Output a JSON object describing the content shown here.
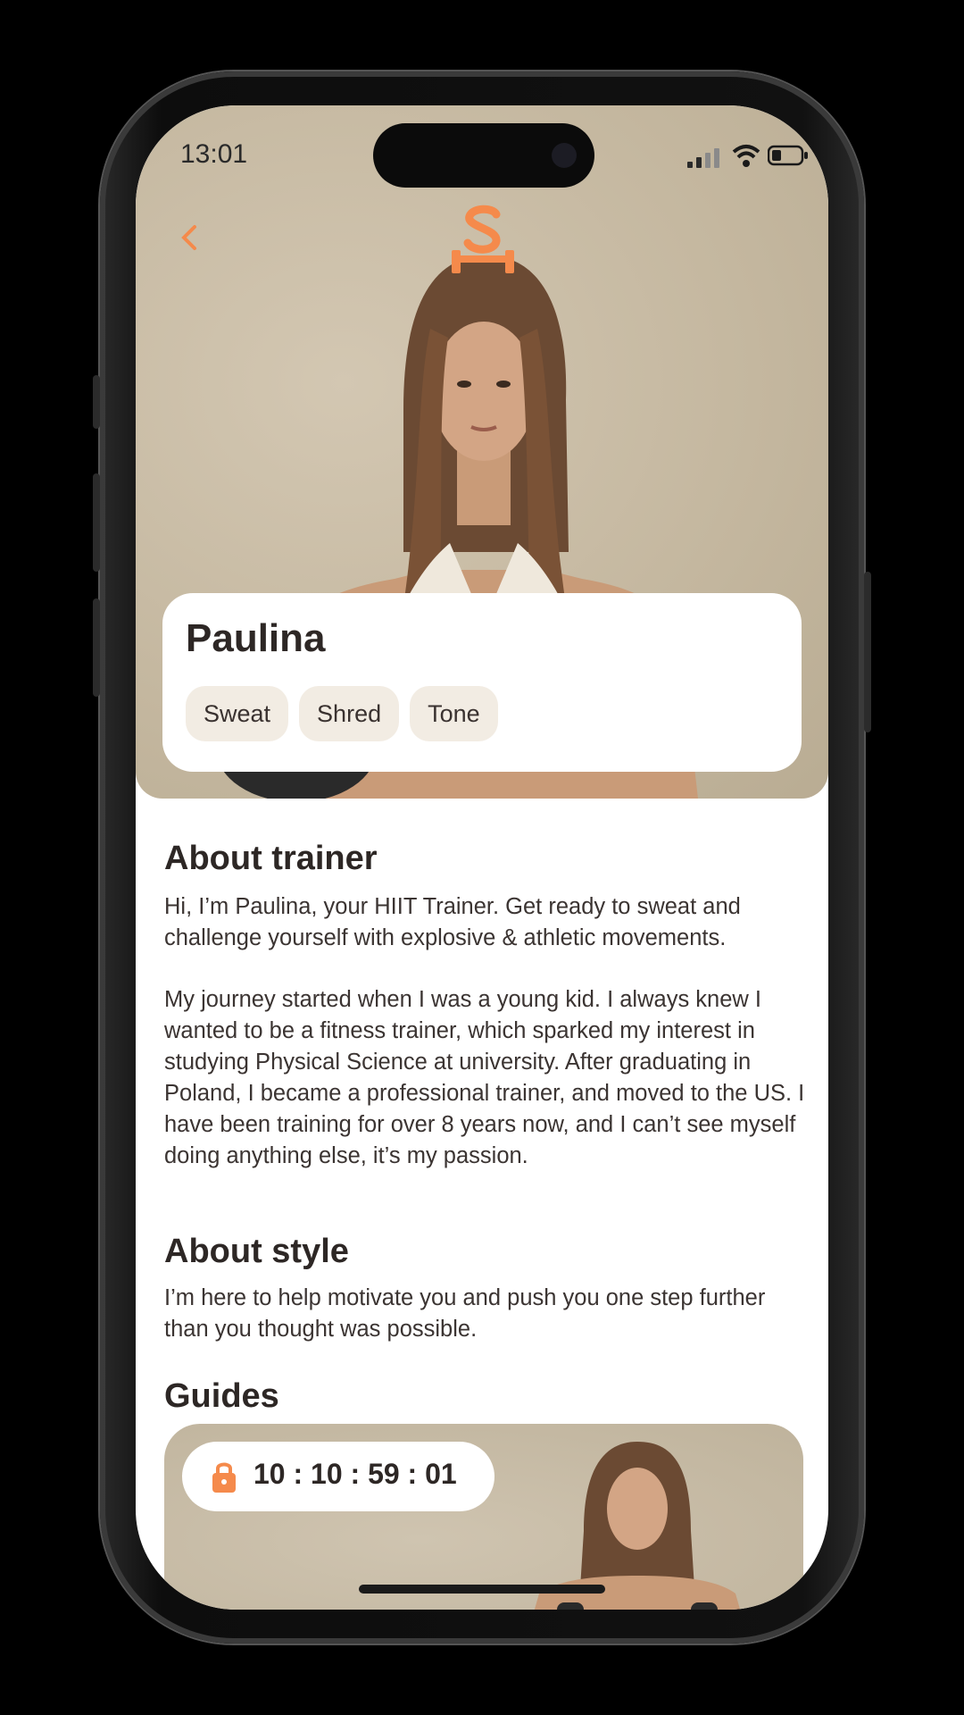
{
  "status_bar": {
    "time": "13:01"
  },
  "trainer": {
    "name": "Paulina",
    "tags": [
      "Sweat",
      "Shred",
      "Tone"
    ]
  },
  "about_trainer": {
    "title": "About trainer",
    "paragraph1": "Hi, I’m Paulina, your HIIT Trainer. Get ready to sweat and challenge yourself with explosive & athletic movements.",
    "paragraph2": "My journey started when I was a young kid. I always knew I wanted to be a fitness trainer, which sparked my interest in studying Physical Science at university. After graduating in Poland, I became a professional trainer, and moved to the US. I have been training for over 8 years now, and I can’t see myself doing anything else, it’s my passion."
  },
  "about_style": {
    "title": "About style",
    "text": "I’m here to help motivate you and push you one step further than you thought was possible."
  },
  "guides": {
    "title": "Guides",
    "timer": "10 : 10 : 59 : 01"
  },
  "colors": {
    "accent": "#f58a4b",
    "text_dark": "#2d2725",
    "tag_bg": "#f2ece3",
    "hero_bg": "#c9bca6"
  },
  "icons": [
    "back-chevron-icon",
    "brand-logo-icon",
    "signal-icon",
    "wifi-icon",
    "battery-icon",
    "lock-icon"
  ]
}
